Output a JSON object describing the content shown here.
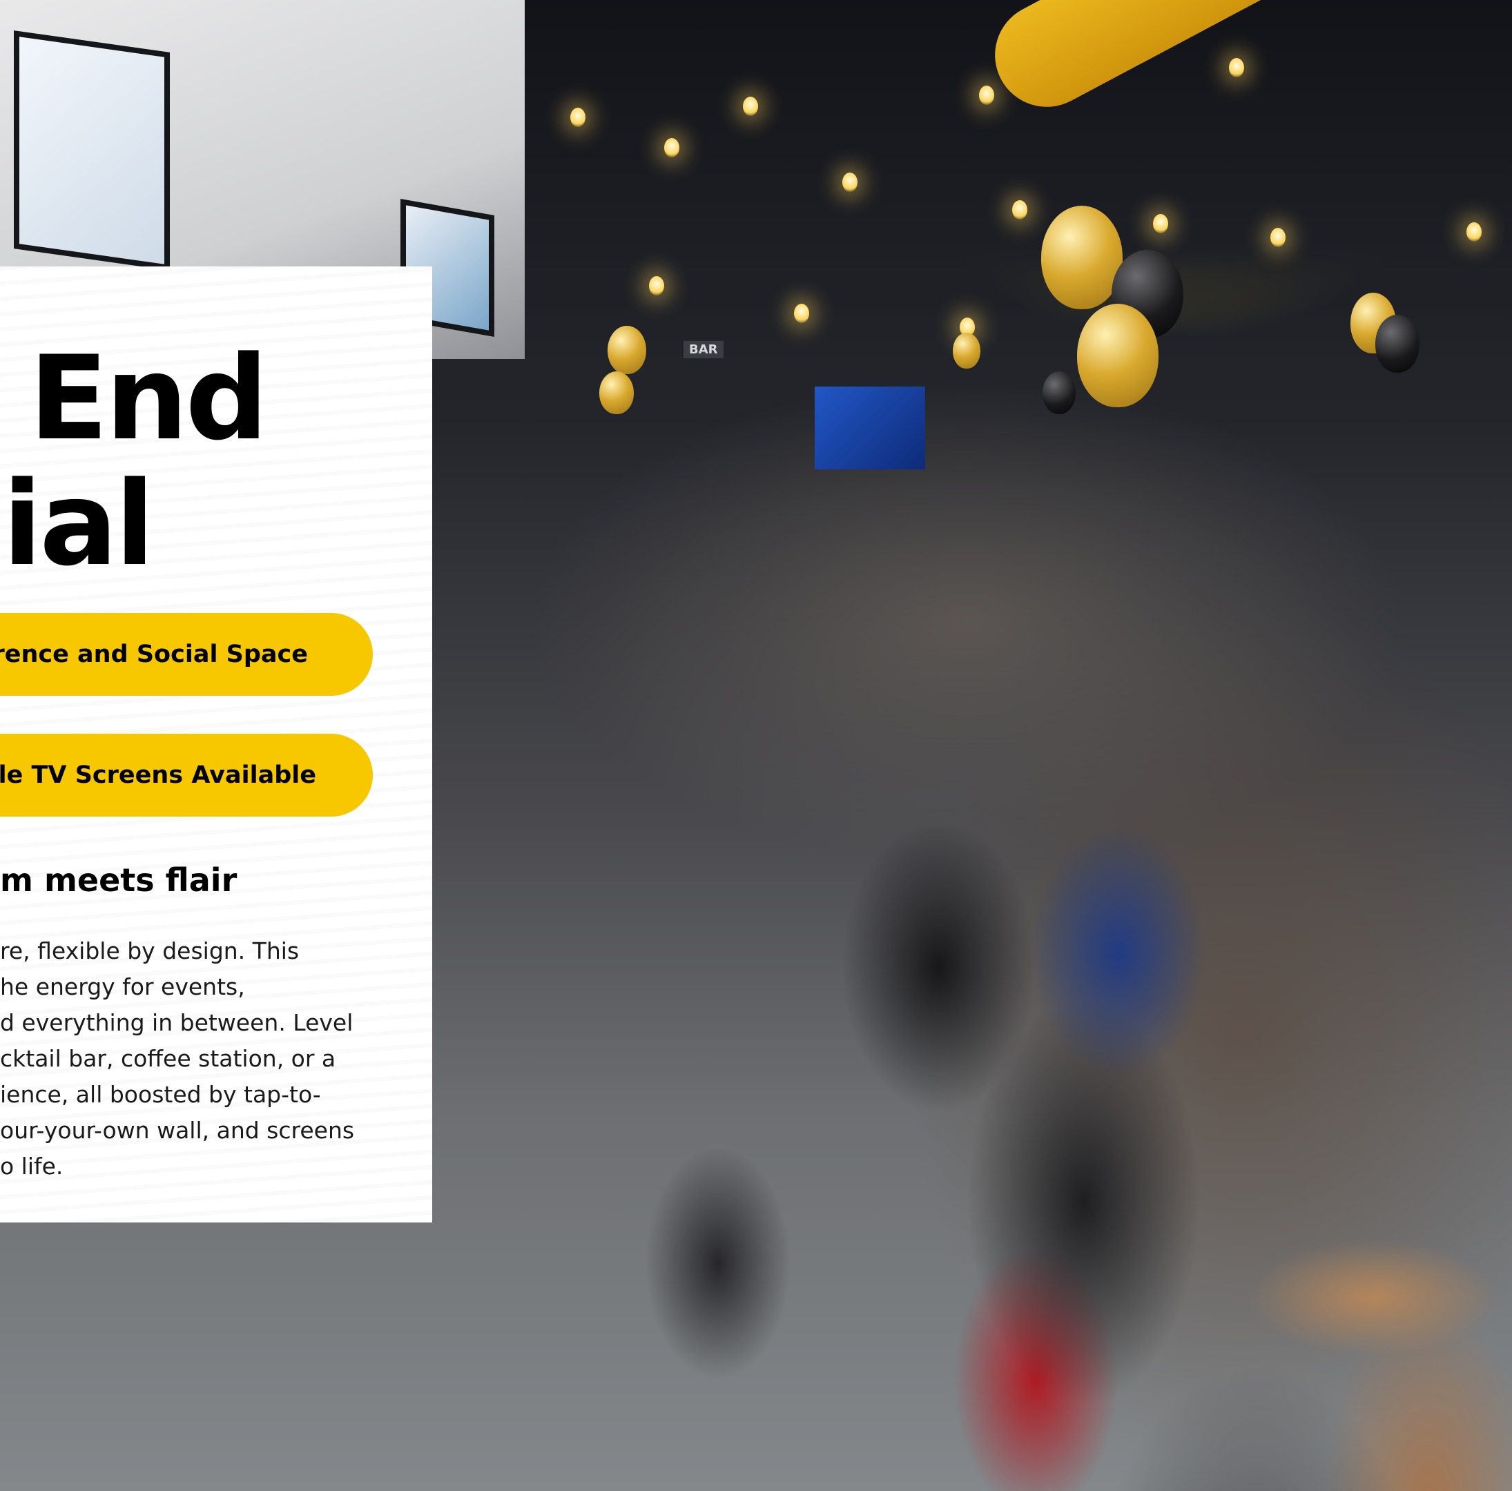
{
  "hero": {
    "title_line1": "y End",
    "title_line2": "cial",
    "pill1_label": "rence and Social Space",
    "pill2_label": "ble TV Screens Available",
    "subheading": "m meets flair",
    "body_lines": [
      "re, flexible by design. This",
      "he energy for events,",
      "d everything in between. Level",
      "cktail bar, coffee station, or a",
      "ience, all boosted by tap-to-",
      "our-your-own wall, and screens",
      "o life."
    ]
  },
  "colors": {
    "accent_yellow": "#f7c700",
    "card_background": "#ffffff",
    "text_primary": "#000000"
  },
  "background": {
    "signage_bar_text": "BAR"
  }
}
